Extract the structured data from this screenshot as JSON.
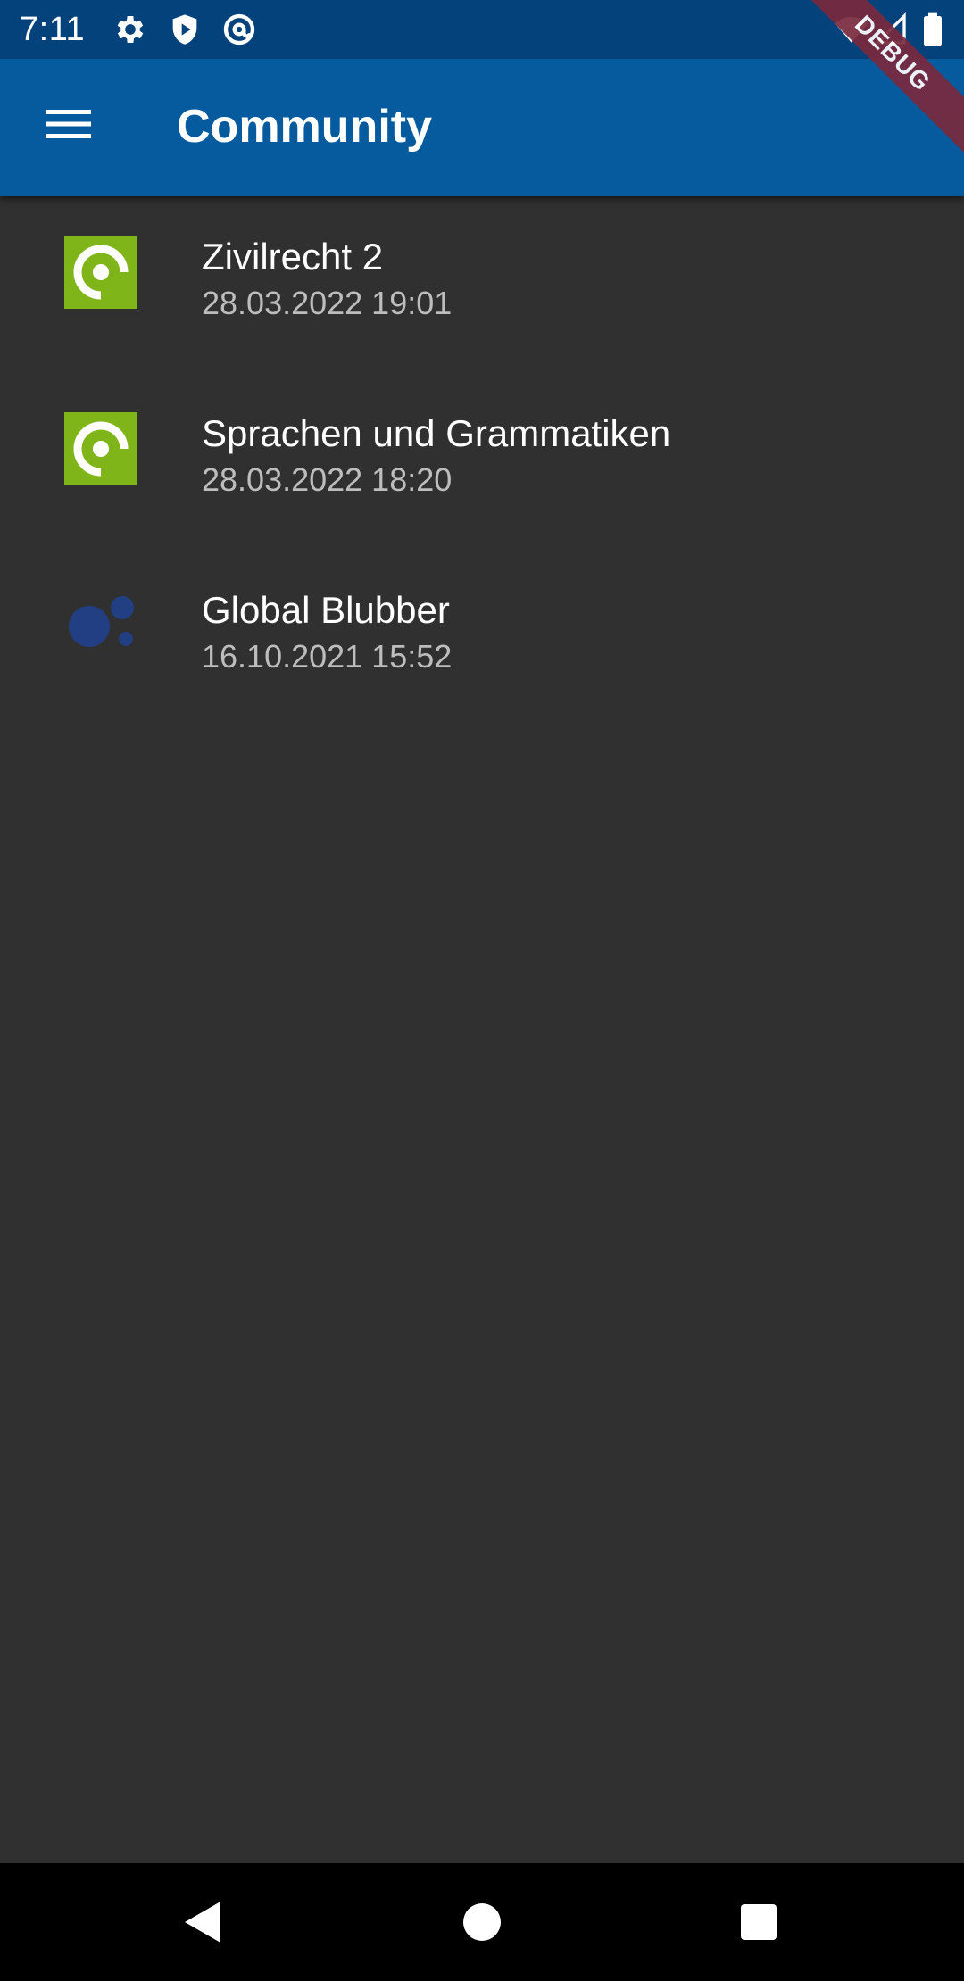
{
  "status_bar": {
    "time": "7:11",
    "icons_left": [
      "gear-icon",
      "shield-play-icon",
      "at-sign-icon"
    ],
    "icons_right": [
      "wifi-icon",
      "signal-icon",
      "battery-icon"
    ]
  },
  "debug_banner": {
    "label": "DEBUG"
  },
  "app_bar": {
    "title": "Community",
    "menu_icon": "menu-icon"
  },
  "communities": [
    {
      "title": "Zivilrecht 2",
      "timestamp": "28.03.2022 19:01",
      "icon": "green-ring-logo-icon"
    },
    {
      "title": "Sprachen und Grammatiken",
      "timestamp": "28.03.2022 18:20",
      "icon": "green-ring-logo-icon"
    },
    {
      "title": "Global Blubber",
      "timestamp": "16.10.2021 15:52",
      "icon": "blue-dots-logo-icon"
    }
  ],
  "nav_bar": {
    "buttons": [
      "back-icon",
      "home-icon",
      "recents-icon"
    ]
  },
  "colors": {
    "status_bar": "#04427c",
    "app_bar": "#065a9e",
    "background": "#303030",
    "accent_green": "#7fb518",
    "dots_blue": "#233f84",
    "debug_banner": "#7a2a3e",
    "subtitle": "#bdbdbd"
  }
}
